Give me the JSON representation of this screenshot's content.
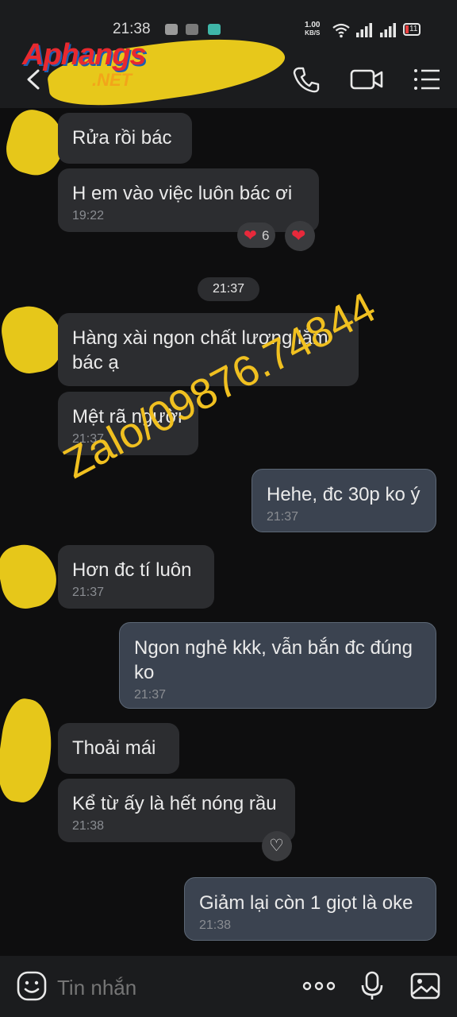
{
  "status": {
    "time": "21:38",
    "speed_value": "1.00",
    "speed_unit": "KB/S",
    "battery": "11"
  },
  "header": {
    "logo_main": "Aphangs",
    "logo_sub": ".NET"
  },
  "date_divider": "21:37",
  "messages": [
    {
      "text": "Rửa rồi bác",
      "time": ""
    },
    {
      "text": "H em vào việc luôn bác ơi",
      "time": "19:22"
    },
    {
      "text": "Hàng xài ngon chất lượng lắm bác ạ",
      "time": ""
    },
    {
      "text": "Mệt rã người",
      "time": "21:37"
    },
    {
      "text": "Hehe, đc 30p ko ý",
      "time": "21:37"
    },
    {
      "text": "Hơn đc tí luôn",
      "time": "21:37"
    },
    {
      "text": "Ngon nghẻ kkk, vẫn bắn đc đúng ko",
      "time": "21:37"
    },
    {
      "text": "Thoải mái",
      "time": ""
    },
    {
      "text": "Kể từ ấy là hết nóng rầu",
      "time": "21:38"
    },
    {
      "text": "Giảm lại còn 1 giọt là oke",
      "time": "21:38"
    }
  ],
  "reaction_count": "6",
  "watermark": "Zalo/09876.74844",
  "input": {
    "placeholder": "Tin nhắn"
  },
  "colors": {
    "accent_yellow": "#f2d21b",
    "bubble_in": "#2c2d30",
    "bubble_out": "#3b4350",
    "heart": "#e8293b"
  }
}
